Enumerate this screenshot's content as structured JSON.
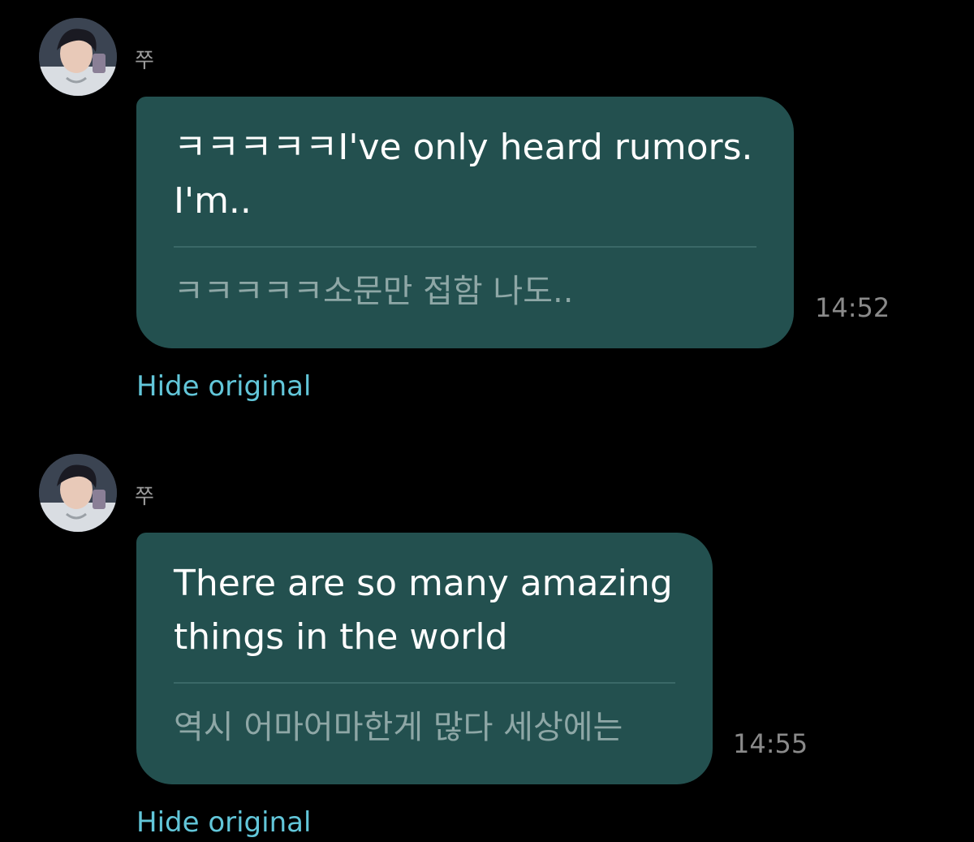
{
  "messages": [
    {
      "sender": "쭈",
      "avatar_icon": "user-avatar-photo",
      "translated": "ㅋㅋㅋㅋㅋI've only heard rumors. I'm..",
      "original": "ㅋㅋㅋㅋㅋ소문만 접함 나도..",
      "time": "14:52",
      "hide_original_label": "Hide original"
    },
    {
      "sender": "쭈",
      "avatar_icon": "user-avatar-photo",
      "translated": "There are so many amazing things in the world",
      "original": "역시 어마어마한게 많다 세상에는",
      "time": "14:55",
      "hide_original_label": "Hide original"
    }
  ],
  "colors": {
    "background": "#000000",
    "bubble": "#23504f",
    "link": "#62c6d9",
    "timestamp": "#8a8a8a"
  }
}
